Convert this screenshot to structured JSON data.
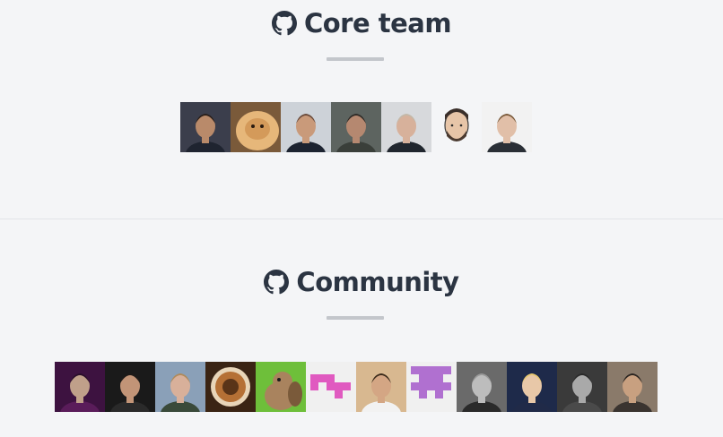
{
  "core": {
    "heading": "Core team",
    "icon": "github-icon",
    "members": [
      {
        "avatar": "person-avatar",
        "bg": "#3b3e4c",
        "skin": "#b98a6a",
        "hair": "#2a1f1a",
        "shirt": "#1f2430"
      },
      {
        "avatar": "cat-avatar",
        "bg": "#7a5a3a",
        "skin": "#d49a5a",
        "hair": "#e6b77a",
        "shirt": "#c38a50"
      },
      {
        "avatar": "person-avatar",
        "bg": "#cdd2d8",
        "skin": "#c99a7a",
        "hair": "#6a4a3a",
        "shirt": "#1c2330"
      },
      {
        "avatar": "person-avatar",
        "bg": "#5d6460",
        "skin": "#b58870",
        "hair": "#2f2a26",
        "shirt": "#3a3f3a"
      },
      {
        "avatar": "person-avatar",
        "bg": "#d7d9dc",
        "skin": "#d7b19b",
        "hair": "#c3b8a8",
        "shirt": "#20262e"
      },
      {
        "avatar": "cartoon-avatar",
        "bg": "#f4f5f7",
        "skin": "#e7c5a8",
        "hair": "#3a2f2a",
        "shirt": "#f4f5f7"
      },
      {
        "avatar": "person-avatar",
        "bg": "#f2f2f2",
        "skin": "#e1bfa8",
        "hair": "#7a5a3a",
        "shirt": "#2a2f36"
      }
    ]
  },
  "community": {
    "heading": "Community",
    "icon": "github-icon",
    "members": [
      {
        "avatar": "person-avatar",
        "bg": "#3d1240",
        "skin": "#c0a08a",
        "hair": "#2a0f2a",
        "shirt": "#5a1c5a"
      },
      {
        "avatar": "person-avatar",
        "bg": "#1a1a1a",
        "skin": "#c29477",
        "hair": "#1e1a18",
        "shirt": "#2a2a2a"
      },
      {
        "avatar": "person-avatar",
        "bg": "#8aa0b8",
        "skin": "#d8b09a",
        "hair": "#b08a5a",
        "shirt": "#3a4a3a"
      },
      {
        "avatar": "coffee-avatar",
        "bg": "#3a2414",
        "skin": "#b57035",
        "hair": "#5a3418",
        "shirt": "#e8d5b8"
      },
      {
        "avatar": "squirrel-avatar",
        "bg": "#6ebf3a",
        "skin": "#a9835e",
        "hair": "#7a5a3a",
        "shirt": "#6ebf3a"
      },
      {
        "avatar": "identicon-avatar",
        "bg": "#f0f0f0",
        "skin": "#e05ac0",
        "hair": "#e05ac0",
        "shirt": "#f0f0f0"
      },
      {
        "avatar": "person-avatar",
        "bg": "#d8b890",
        "skin": "#d4a684",
        "hair": "#3a2a1a",
        "shirt": "#f2f2f2"
      },
      {
        "avatar": "identicon-avatar-2",
        "bg": "#f0f0f0",
        "skin": "#b070d0",
        "hair": "#b070d0",
        "shirt": "#f0f0f0"
      },
      {
        "avatar": "person-avatar",
        "bg": "#6a6a6a",
        "skin": "#bdbdbd",
        "hair": "#9a9a9a",
        "shirt": "#2a2a2a"
      },
      {
        "avatar": "person-avatar",
        "bg": "#1e2a4a",
        "skin": "#e8c8a8",
        "hair": "#e8c870",
        "shirt": "#202a48"
      },
      {
        "avatar": "person-avatar",
        "bg": "#3a3a3a",
        "skin": "#a9a9a9",
        "hair": "#2a2a2a",
        "shirt": "#4a4a4a"
      },
      {
        "avatar": "person-avatar",
        "bg": "#8a7a6a",
        "skin": "#c8a080",
        "hair": "#2a2420",
        "shirt": "#3a3430"
      }
    ]
  }
}
